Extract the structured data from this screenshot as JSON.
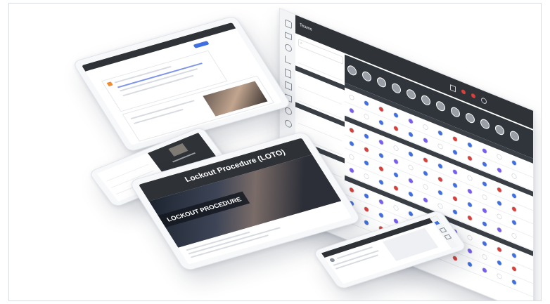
{
  "desktop": {
    "sidebar": {
      "teams_label": "Teams",
      "search_placeholder": "Search"
    },
    "table": {
      "header_cells": 12,
      "rows": [
        {
          "type": "section"
        },
        {
          "type": "row"
        },
        {
          "type": "row"
        },
        {
          "type": "section"
        },
        {
          "type": "row"
        },
        {
          "type": "row"
        },
        {
          "type": "row"
        },
        {
          "type": "row"
        },
        {
          "type": "section"
        },
        {
          "type": "row"
        },
        {
          "type": "row"
        },
        {
          "type": "row"
        }
      ]
    },
    "colors": {
      "topbar": "#2f3338",
      "status_red": "#d9403a",
      "status_blue": "#3f6fe0",
      "status_purple": "#7b5cf0",
      "status_green": "#36b37e"
    }
  },
  "tablet_bottom": {
    "title": "Lockout Procedure (LOTO)",
    "slide_text": "LOCKOUT PROCEDURE"
  },
  "phone_bottom": {
    "post_user": ""
  },
  "icons": [
    "home-icon",
    "search-icon",
    "bell-icon",
    "user-icon",
    "settings-icon"
  ]
}
